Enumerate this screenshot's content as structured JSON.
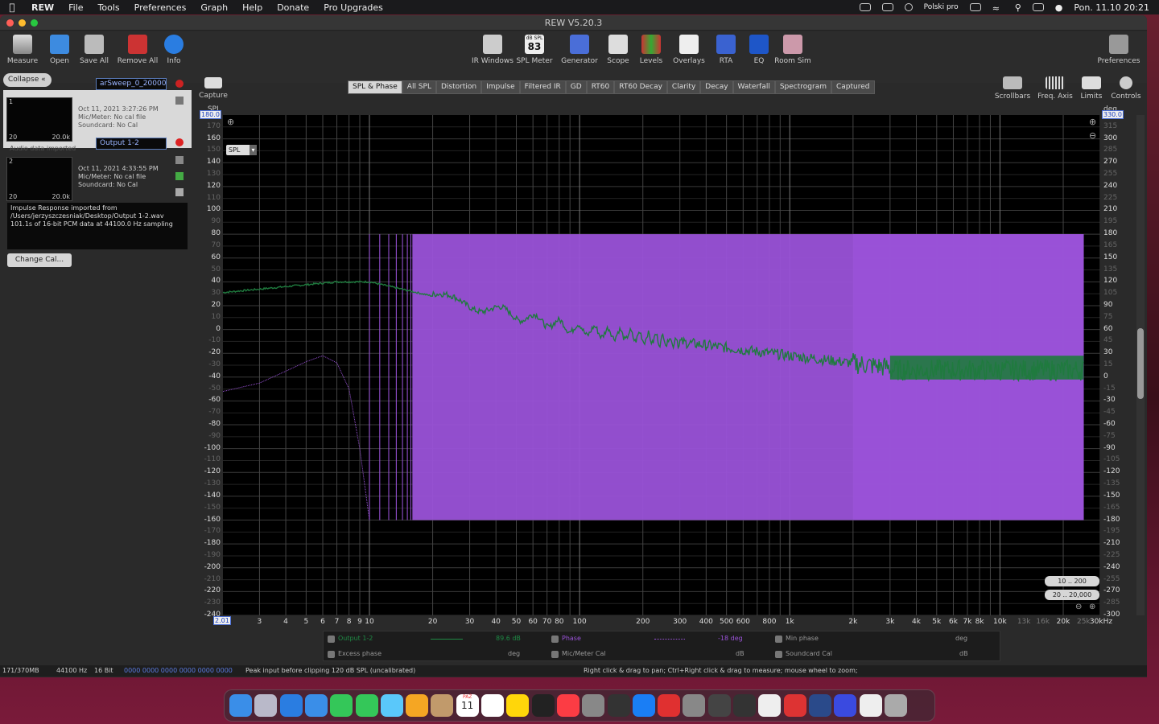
{
  "menubar": {
    "app": "REW",
    "items": [
      "File",
      "Tools",
      "Preferences",
      "Graph",
      "Help",
      "Donate",
      "Pro Upgrades"
    ],
    "input_source": "Polski pro",
    "clock": "Pon. 11.10  20:21"
  },
  "window": {
    "title": "REW V5.20.3"
  },
  "toolbar": {
    "left": [
      "Measure",
      "Open",
      "Save All",
      "Remove All",
      "Info"
    ],
    "center": [
      "IR Windows",
      "SPL Meter",
      "Generator",
      "Scope",
      "Levels",
      "Overlays",
      "RTA",
      "EQ",
      "Room Sim"
    ],
    "spl_meter_top": "dB SPL",
    "spl_meter_value": "83",
    "right": [
      "Preferences"
    ],
    "capture": "Capture",
    "graph_tools": [
      "Scrollbars",
      "Freq. Axis",
      "Limits",
      "Controls"
    ]
  },
  "tabs": [
    "SPL & Phase",
    "All SPL",
    "Distortion",
    "Impulse",
    "Filtered IR",
    "GD",
    "RT60",
    "RT60 Decay",
    "Clarity",
    "Decay",
    "Waterfall",
    "Spectrogram",
    "Captured"
  ],
  "active_tab": "SPL & Phase",
  "panel": {
    "collapse": "Collapse",
    "measurements": [
      {
        "index": "1",
        "name": "arSweep_0_20000_",
        "date": "Oct 11, 2021 3:27:26 PM",
        "mic": "Mic/Meter: No cal file",
        "soundcard": "Soundcard: No Cal",
        "thumb_left": "20",
        "thumb_right": "20.0k",
        "note": "Audio data imported"
      },
      {
        "index": "2",
        "name": "Output 1-2",
        "date": "Oct 11, 2021 4:33:55 PM",
        "mic": "Mic/Meter: No cal file",
        "soundcard": "Soundcard: No Cal",
        "thumb_left": "20",
        "thumb_right": "20.0k"
      }
    ],
    "import_lines": [
      "Impulse Response imported from",
      "/Users/jerzyszczesniak/Desktop/Output 1-2.wav",
      "101.1s of 16-bit PCM data at 44100.0 Hz sampling"
    ],
    "change_cal": "Change Cal..."
  },
  "graph": {
    "left_axis_title": "SPL",
    "left_axis_top": "180.0",
    "right_axis_title": "deg",
    "right_axis_top": "330.0",
    "x_axis_min": "2.01",
    "x_axis_unit_last": "30kHz",
    "y_selector": "SPL",
    "left_ticks": [
      "170",
      "160",
      "150",
      "140",
      "130",
      "120",
      "110",
      "100",
      "90",
      "80",
      "70",
      "60",
      "50",
      "40",
      "30",
      "20",
      "10",
      "0",
      "-10",
      "-20",
      "-30",
      "-40",
      "-50",
      "-60",
      "-70",
      "-80",
      "-90",
      "-100",
      "-110",
      "-120",
      "-130",
      "-140",
      "-150",
      "-160",
      "-170",
      "-180",
      "-190",
      "-200",
      "-210",
      "-220",
      "-230",
      "-240"
    ],
    "right_ticks": [
      "315",
      "300",
      "285",
      "270",
      "255",
      "240",
      "225",
      "210",
      "195",
      "180",
      "165",
      "150",
      "135",
      "120",
      "105",
      "90",
      "75",
      "60",
      "45",
      "30",
      "15",
      "0",
      "-15",
      "-30",
      "-45",
      "-60",
      "-75",
      "-90",
      "-105",
      "-120",
      "-135",
      "-150",
      "-165",
      "-180",
      "-195",
      "-210",
      "-225",
      "-240",
      "-255",
      "-270",
      "-285",
      "-300"
    ],
    "x_ticks": [
      {
        "label": "3",
        "f": 3
      },
      {
        "label": "4",
        "f": 4
      },
      {
        "label": "5",
        "f": 5
      },
      {
        "label": "6",
        "f": 6
      },
      {
        "label": "7",
        "f": 7
      },
      {
        "label": "8",
        "f": 8
      },
      {
        "label": "9",
        "f": 9
      },
      {
        "label": "10",
        "f": 10
      },
      {
        "label": "20",
        "f": 20
      },
      {
        "label": "30",
        "f": 30
      },
      {
        "label": "40",
        "f": 40
      },
      {
        "label": "50",
        "f": 50
      },
      {
        "label": "60",
        "f": 60
      },
      {
        "label": "70",
        "f": 70
      },
      {
        "label": "80",
        "f": 80
      },
      {
        "label": "100",
        "f": 100
      },
      {
        "label": "200",
        "f": 200
      },
      {
        "label": "300",
        "f": 300
      },
      {
        "label": "400",
        "f": 400
      },
      {
        "label": "500",
        "f": 500
      },
      {
        "label": "600",
        "f": 600
      },
      {
        "label": "800",
        "f": 800
      },
      {
        "label": "1k",
        "f": 1000
      },
      {
        "label": "2k",
        "f": 2000
      },
      {
        "label": "3k",
        "f": 3000
      },
      {
        "label": "4k",
        "f": 4000
      },
      {
        "label": "5k",
        "f": 5000
      },
      {
        "label": "6k",
        "f": 6000
      },
      {
        "label": "7k",
        "f": 7000
      },
      {
        "label": "8k",
        "f": 8000
      },
      {
        "label": "10k",
        "f": 10000
      },
      {
        "label": "13k",
        "f": 13000,
        "dim": true
      },
      {
        "label": "16k",
        "f": 16000,
        "dim": true
      },
      {
        "label": "20k",
        "f": 20000
      },
      {
        "label": "25k",
        "f": 25000,
        "dim": true
      }
    ],
    "range_buttons": [
      "10 .. 200",
      "20 .. 20,000"
    ],
    "colors": {
      "spl": "#1f7a3e",
      "phase": "#9a52d8"
    }
  },
  "legend": {
    "rows": [
      [
        {
          "label": "Output 1-2",
          "value": "89.6 dB",
          "color": "#1f8a45",
          "checked": true
        },
        {
          "label": "Phase",
          "value": "-18 deg",
          "color": "#9a52d8",
          "checked": true
        },
        {
          "label": "Min phase",
          "value": "deg",
          "checked": true
        }
      ],
      [
        {
          "label": "Excess phase",
          "value": "deg",
          "checked": true
        },
        {
          "label": "Mic/Meter Cal",
          "value": "dB",
          "checked": true
        },
        {
          "label": "Soundcard Cal",
          "value": "dB",
          "checked": true
        }
      ]
    ]
  },
  "status": {
    "memory": "171/370MB",
    "rate": "44100 Hz",
    "bits": "16 Bit",
    "level": "0000 0000  0000 0000  0000 0000",
    "clip": "Peak input before clipping 120 dB SPL (uncalibrated)",
    "hint": "Right click & drag to pan; Ctrl+Right click & drag to measure; mouse wheel to zoom;"
  },
  "dock": {
    "apps": [
      "Finder",
      "Launchpad",
      "Safari",
      "Mail",
      "FaceTime",
      "Messages",
      "Maps",
      "Photos",
      "Contacts",
      "Calendar",
      "Reminders",
      "Notes",
      "Roon",
      "Music",
      "Disk Utility",
      "Instruments",
      "App Store",
      "Flashpoint",
      "System Preferences",
      "Calibration",
      "Sound Utility",
      "Karaoke",
      "REW",
      "Studio",
      "Affinity",
      "Terminal",
      "Trash"
    ],
    "calendar_day": "11",
    "calendar_month": "PAŹ"
  }
}
